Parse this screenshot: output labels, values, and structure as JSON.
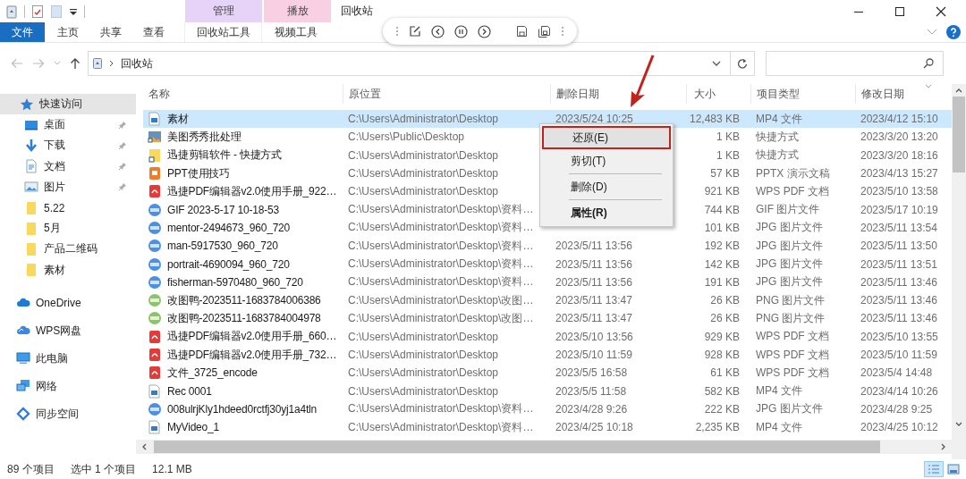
{
  "window": {
    "title": "回收站"
  },
  "ribbon": {
    "file_tab": "文件",
    "tabs": [
      "主页",
      "共享",
      "查看"
    ],
    "context_tabs": [
      {
        "header": "管理",
        "label": "回收站工具",
        "color": "#e6d3f7"
      },
      {
        "header": "播放",
        "label": "视频工具",
        "color": "#f9cfe3"
      }
    ]
  },
  "address": {
    "path": "回收站"
  },
  "sidebar": {
    "items": [
      {
        "label": "快速访问",
        "kind": "star",
        "selected": true,
        "children": [
          {
            "label": "桌面",
            "kind": "desktop",
            "pinned": true,
            "selected": false
          },
          {
            "label": "下载",
            "kind": "download",
            "pinned": true,
            "selected": false
          },
          {
            "label": "文档",
            "kind": "document",
            "pinned": true,
            "selected": false
          },
          {
            "label": "图片",
            "kind": "pictures",
            "pinned": true,
            "selected": false
          },
          {
            "label": "5.22",
            "kind": "folder",
            "pinned": false,
            "selected": false
          },
          {
            "label": "5月",
            "kind": "folder",
            "pinned": false,
            "selected": false
          },
          {
            "label": "产品二维码",
            "kind": "folder",
            "pinned": false,
            "selected": false
          },
          {
            "label": "素材",
            "kind": "folder",
            "pinned": false,
            "selected": false
          }
        ]
      },
      {
        "label": "OneDrive",
        "kind": "cloud",
        "selected": false
      },
      {
        "label": "WPS网盘",
        "kind": "cloud2",
        "selected": false
      },
      {
        "label": "此电脑",
        "kind": "computer",
        "selected": false
      },
      {
        "label": "网络",
        "kind": "network",
        "selected": false
      },
      {
        "label": "同步空间",
        "kind": "sync",
        "selected": false
      }
    ]
  },
  "table": {
    "columns": [
      "名称",
      "原位置",
      "删除日期",
      "大小",
      "项目类型",
      "修改日期"
    ],
    "rows": [
      {
        "kind": "video",
        "selected": true,
        "name": "素材",
        "location": "C:\\Users\\Administrator\\Desktop",
        "deleted": "2023/5/24 10:25",
        "size": "12,483 KB",
        "type": "MP4 文件",
        "modified": "2023/4/12 15:10"
      },
      {
        "kind": "image-shortcut",
        "selected": false,
        "name": "美图秀秀批处理",
        "location": "C:\\Users\\Public\\Desktop",
        "size": "1 KB",
        "type": "快捷方式",
        "modified": "2023/3/20 13:20"
      },
      {
        "kind": "folder-shortcut",
        "selected": false,
        "name": "迅捷剪辑软件 - 快捷方式",
        "location": "C:\\Users\\Administrator\\Desktop",
        "size": "1 KB",
        "type": "快捷方式",
        "modified": "2023/3/20 18:16"
      },
      {
        "kind": "ppt",
        "selected": false,
        "name": "PPT使用技巧",
        "location": "C:\\Users\\Administrator\\Desktop",
        "size": "57 KB",
        "type": "PPTX 演示文稿",
        "modified": "2023/4/13 15:27"
      },
      {
        "kind": "pdf",
        "selected": false,
        "name": "迅捷PDF编辑器v2.0使用手册_922…",
        "location": "C:\\Users\\Administrator\\Desktop",
        "size": "921 KB",
        "type": "WPS PDF 文档",
        "modified": "2023/5/10 13:58"
      },
      {
        "kind": "gif",
        "selected": false,
        "name": "GIF 2023-5-17 10-18-53",
        "location": "C:\\Users\\Administrator\\Desktop\\资料…",
        "size": "744 KB",
        "type": "GIF 图片文件",
        "modified": "2023/5/17 10:19"
      },
      {
        "kind": "jpg",
        "selected": false,
        "name": "mentor-2494673_960_720",
        "location": "C:\\Users\\Administrator\\Desktop\\资料…",
        "size": "101 KB",
        "type": "JPG 图片文件",
        "modified": "2023/5/11 13:54"
      },
      {
        "kind": "jpg",
        "selected": false,
        "name": "man-5917530_960_720",
        "location": "C:\\Users\\Administrator\\Desktop\\资料…",
        "deleted": "2023/5/11 13:56",
        "size": "192 KB",
        "type": "JPG 图片文件",
        "modified": "2023/5/11 13:50"
      },
      {
        "kind": "jpg",
        "selected": false,
        "name": "portrait-4690094_960_720",
        "location": "C:\\Users\\Administrator\\Desktop\\资料…",
        "deleted": "2023/5/11 13:56",
        "size": "142 KB",
        "type": "JPG 图片文件",
        "modified": "2023/5/11 13:51"
      },
      {
        "kind": "jpg",
        "selected": false,
        "name": "fisherman-5970480_960_720",
        "location": "C:\\Users\\Administrator\\Desktop\\资料…",
        "deleted": "2023/5/11 13:56",
        "size": "191 KB",
        "type": "JPG 图片文件",
        "modified": "2023/5/11 13:46"
      },
      {
        "kind": "png",
        "selected": false,
        "name": "改图鸭-2023511-1683784006386",
        "location": "C:\\Users\\Administrator\\Desktop\\改图…",
        "deleted": "2023/5/11 13:47",
        "size": "26 KB",
        "type": "PNG 图片文件",
        "modified": "2023/5/11 13:46"
      },
      {
        "kind": "png",
        "selected": false,
        "name": "改图鸭-2023511-1683784004978",
        "location": "C:\\Users\\Administrator\\Desktop\\改图…",
        "deleted": "2023/5/11 13:47",
        "size": "26 KB",
        "type": "PNG 图片文件",
        "modified": "2023/5/11 13:46"
      },
      {
        "kind": "pdf",
        "selected": false,
        "name": "迅捷PDF编辑器v2.0使用手册_660…",
        "location": "C:\\Users\\Administrator\\Desktop",
        "deleted": "2023/5/10 13:56",
        "size": "929 KB",
        "type": "WPS PDF 文档",
        "modified": "2023/5/10 13:55"
      },
      {
        "kind": "pdf",
        "selected": false,
        "name": "迅捷PDF编辑器v2.0使用手册_732…",
        "location": "C:\\Users\\Administrator\\Desktop",
        "deleted": "2023/5/10 11:59",
        "size": "928 KB",
        "type": "WPS PDF 文档",
        "modified": "2023/5/10 11:59"
      },
      {
        "kind": "pdf",
        "selected": false,
        "name": "文件_3725_encode",
        "location": "C:\\Users\\Administrator\\Desktop",
        "deleted": "2023/5/5 16:58",
        "size": "61 KB",
        "type": "WPS PDF 文档",
        "modified": "2023/5/4 14:48"
      },
      {
        "kind": "video",
        "selected": false,
        "name": "Rec 0001",
        "location": "C:\\Users\\Administrator\\Desktop",
        "deleted": "2023/5/5 11:58",
        "size": "582 KB",
        "type": "MP4 文件",
        "modified": "2023/4/14 10:26"
      },
      {
        "kind": "jpg",
        "selected": false,
        "name": "008ulrjKly1hdeed0rctfj30yj1a4tln",
        "location": "C:\\Users\\Administrator\\Desktop\\资料…",
        "deleted": "2023/4/28 9:26",
        "size": "222 KB",
        "type": "JPG 图片文件",
        "modified": "2023/4/28 9:25"
      },
      {
        "kind": "video",
        "selected": false,
        "name": "MyVideo_1",
        "location": "C:\\Users\\Administrator\\Desktop\\资料…",
        "deleted": "2023/4/25 10:18",
        "size": "2,235 KB",
        "type": "MP4 文件",
        "modified": "2023/4/25 10:12"
      }
    ]
  },
  "context_menu": {
    "items": [
      {
        "label": "还原(E)",
        "highlighted": true,
        "bold": false
      },
      {
        "label": "剪切(T)",
        "highlighted": false,
        "bold": false
      },
      {
        "label": "删除(D)",
        "highlighted": false,
        "bold": false
      },
      {
        "label": "属性(R)",
        "highlighted": false,
        "bold": true
      }
    ]
  },
  "status_bar": {
    "count": "89 个项目",
    "selection": "选中 1 个项目",
    "size": "12.1 MB",
    "view_buttons": [
      {
        "kind": "details",
        "selected": true
      },
      {
        "kind": "icons",
        "selected": false
      }
    ]
  }
}
